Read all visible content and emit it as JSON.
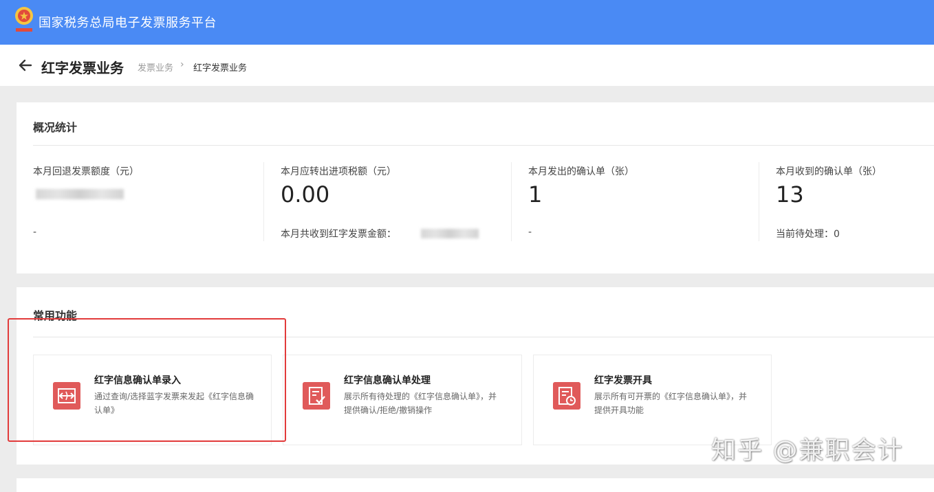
{
  "header": {
    "app_title": "国家税务总局电子发票服务平台",
    "bg_color": "#4a8af4",
    "logo_icon": "tax-emblem-icon"
  },
  "page": {
    "title": "红字发票业务",
    "breadcrumb": [
      "发票业务",
      "红字发票业务"
    ],
    "back_icon": "arrow-left-icon"
  },
  "overview": {
    "title": "概况统计",
    "stats": [
      {
        "label": "本月回退发票额度（元）",
        "value": "",
        "sub": "-"
      },
      {
        "label": "本月应转出进项税额（元）",
        "value": "0.00",
        "sub": "本月共收到红字发票金额："
      },
      {
        "label": "本月发出的确认单（张）",
        "value": "1",
        "sub": "-"
      },
      {
        "label": "本月收到的确认单（张）",
        "value": "13",
        "sub": "当前待处理：0"
      }
    ]
  },
  "functions": {
    "title": "常用功能",
    "accent_color": "#e05a5a",
    "highlight_color": "#e23a3a",
    "items": [
      {
        "title": "红字信息确认单录入",
        "desc_lines": [
          "通过查询/选择蓝字发票来发起《红字信息确",
          "认单》"
        ],
        "icon": "exchange-arrows-icon"
      },
      {
        "title": "红字信息确认单处理",
        "desc_lines": [
          "展示所有待处理的《红字信息确认单》，并",
          "提供确认/拒绝/撤销操作"
        ],
        "icon": "document-check-icon"
      },
      {
        "title": "红字发票开具",
        "desc_lines": [
          "展示所有可开票的《红字信息确认单》，并",
          "提供开具功能"
        ],
        "icon": "document-clock-icon"
      }
    ]
  },
  "watermark": "知乎 @兼职会计"
}
